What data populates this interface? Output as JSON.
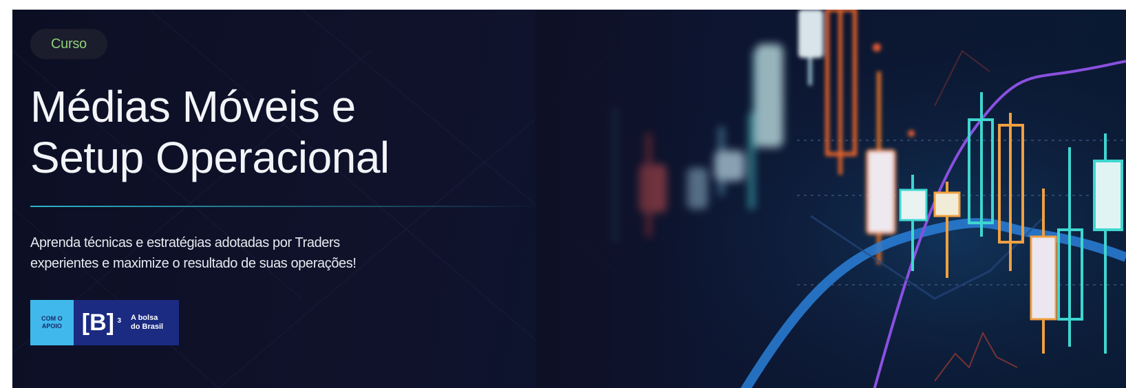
{
  "badge": {
    "label": "Curso"
  },
  "header": {
    "title_line1": "Médias Móveis e",
    "title_line2": "Setup Operacional"
  },
  "description": {
    "line1": "Aprenda técnicas e estratégias adotadas por Traders",
    "line2": "experientes e maximize o resultado de suas operações!"
  },
  "sponsor": {
    "support_line1": "COM O",
    "support_line2": "APOIO",
    "mark": "B",
    "mark_sup": "3",
    "tagline_line1": "A bolsa",
    "tagline_line2": "do Brasil"
  },
  "colors": {
    "background": "#0e1026",
    "badge_text": "#8fd07a",
    "accent_line": "#2fb5c9",
    "logo_light": "#40b8ec",
    "logo_dark": "#1b2b82"
  }
}
